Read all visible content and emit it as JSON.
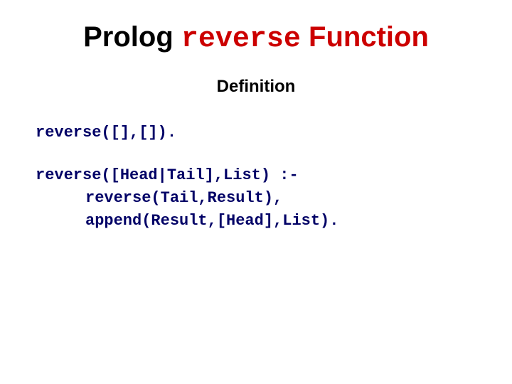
{
  "title": {
    "part1": "Prolog ",
    "part2": "reverse",
    "part3": " Function"
  },
  "subtitle": "Definition",
  "code": {
    "line1": "reverse([],[]).",
    "line2": "reverse([Head|Tail],List) :-",
    "line3": "reverse(Tail,Result),",
    "line4": "append(Result,[Head],List)."
  }
}
